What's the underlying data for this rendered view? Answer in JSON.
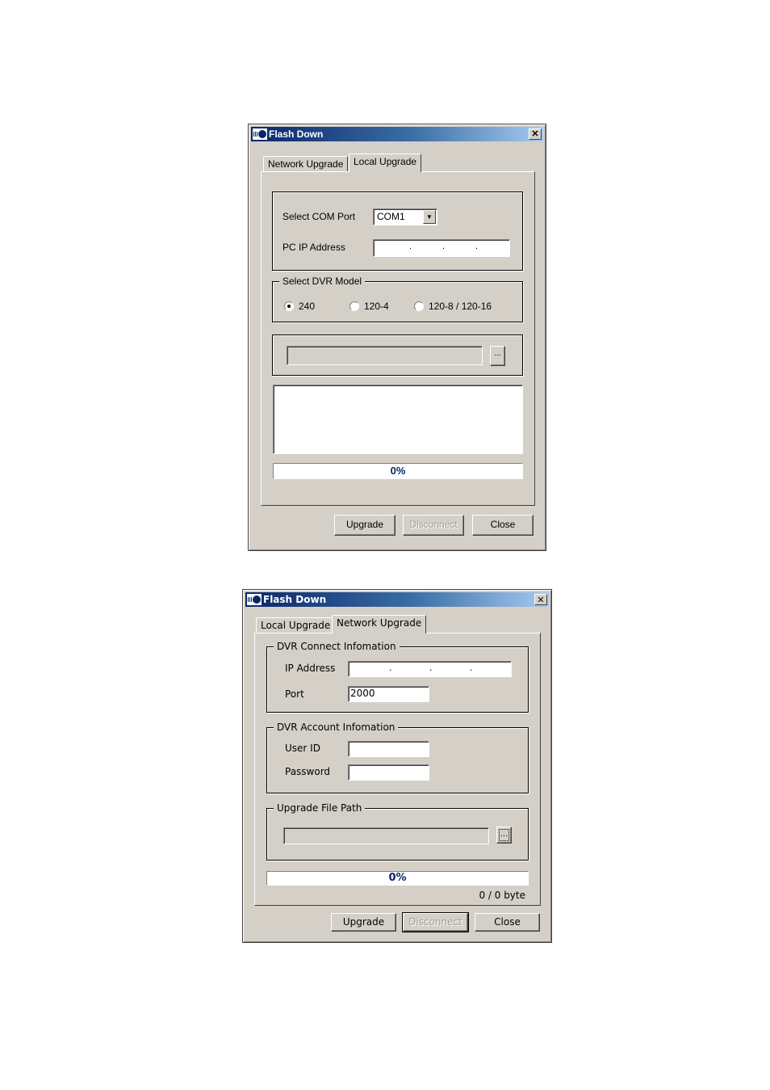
{
  "dialogs": [
    {
      "title": "Flash Down",
      "title_icon": "app-flash-icon",
      "close_glyph": "✕",
      "tabs": [
        {
          "label": "Network Upgrade",
          "active": false
        },
        {
          "label": "Local Upgrade",
          "active": true
        }
      ],
      "com_port": {
        "label": "Select COM Port",
        "value": "COM1"
      },
      "pc_ip": {
        "label": "PC IP Address",
        "value": "",
        "separators": [
          ".",
          ".",
          "."
        ]
      },
      "dvr_model": {
        "legend": "Select DVR Model",
        "options": [
          {
            "label": "240",
            "selected": true
          },
          {
            "label": "120-4",
            "selected": false
          },
          {
            "label": "120-8 / 120-16",
            "selected": false
          }
        ]
      },
      "file_path": {
        "value": "",
        "browse_label": "..."
      },
      "log_text": "",
      "progress": {
        "percent": 0,
        "label": "0%"
      },
      "buttons": {
        "upgrade": "Upgrade",
        "disconnect": "Disconnect",
        "close": "Close"
      }
    },
    {
      "title": "Flash Down",
      "title_icon": "app-flash-icon",
      "close_glyph": "✕",
      "tabs": [
        {
          "label": "Local Upgrade",
          "active": false
        },
        {
          "label": "Network Upgrade",
          "active": true
        }
      ],
      "connect_group": {
        "legend": "DVR Connect Infomation",
        "ip_label": "IP Address",
        "ip_value": "",
        "separators": [
          ".",
          ".",
          "."
        ],
        "port_label": "Port",
        "port_value": "2000"
      },
      "account_group": {
        "legend": "DVR Account Infomation",
        "user_label": "User ID",
        "user_value": "",
        "password_label": "Password",
        "password_value": ""
      },
      "file_group": {
        "legend": "Upgrade File Path",
        "value": "",
        "browse_label": "..."
      },
      "progress": {
        "percent": 0,
        "label": "0%"
      },
      "bytes_status": "0 / 0 byte",
      "buttons": {
        "upgrade": "Upgrade",
        "disconnect": "Disconnect",
        "close": "Close"
      }
    }
  ],
  "colors": {
    "dialog_bg": "#d4d0c8",
    "title_gradient_start": "#0a246a",
    "title_gradient_end": "#a6caf0",
    "progress_text": "#0a246a",
    "disabled_text": "#a0a0a0"
  }
}
